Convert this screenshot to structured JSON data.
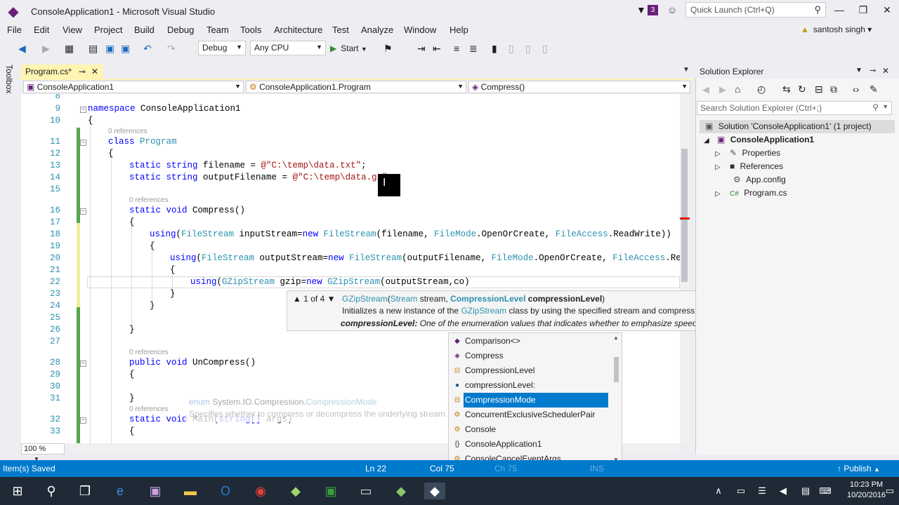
{
  "window": {
    "title": "ConsoleApplication1 - Microsoft Visual Studio",
    "notification_count": "3",
    "quick_launch_placeholder": "Quick Launch (Ctrl+Q)"
  },
  "menu": [
    "File",
    "Edit",
    "View",
    "Project",
    "Build",
    "Debug",
    "Team",
    "Tools",
    "Architecture",
    "Test",
    "Analyze",
    "Window",
    "Help"
  ],
  "user": {
    "name": "santosh singh"
  },
  "toolbar": {
    "config": "Debug",
    "platform": "Any CPU",
    "start_label": "Start"
  },
  "toolbox_label": "Toolbox",
  "document_tab": {
    "label": "Program.cs*"
  },
  "navbar": {
    "project": "ConsoleApplication1",
    "class": "ConsoleApplication1.Program",
    "member": "Compress()"
  },
  "code": {
    "refs_label": "0 references",
    "lines": {
      "l8": "8",
      "l9": "9",
      "l10": "10",
      "l11": "11",
      "l12": "12",
      "l13": "13",
      "l14": "14",
      "l15": "15",
      "l16": "16",
      "l17": "17",
      "l18": "18",
      "l19": "19",
      "l20": "20",
      "l21": "21",
      "l22": "22",
      "l23": "23",
      "l24": "24",
      "l25": "25",
      "l26": "26",
      "l27": "27",
      "l28": "28",
      "l29": "29",
      "l30": "30",
      "l31": "31",
      "l32": "32",
      "l33": "33"
    },
    "ns_kw": "namespace",
    "ns_name": " ConsoleApplication1",
    "open_brace": "{",
    "close_brace": "}",
    "class_kw": "class",
    "class_name": "Program",
    "static_string": "static string",
    "filename_decl": " filename = ",
    "filename_val": "@\"C:\\temp\\data.txt\"",
    "semicolon": ";",
    "output_decl": " outputFilename = ",
    "output_val": "@\"C:\\temp\\data.gz\"",
    "static_void": "static void",
    "compress_sig": " Compress()",
    "using_kw": "using",
    "filestream": "FileStream",
    "new_kw": "new",
    "filemode": "FileMode",
    "fileaccess": "FileAccess",
    "gzipstream": "GZipStream",
    "l18_a": " inputStream=",
    "l18_b": "(filename, ",
    "l18_c": ".OpenOrCreate, ",
    "l18_d": ".ReadWrite))",
    "l20_a": " outputStream=",
    "l20_b": "(outputFilename, ",
    "l20_c": ".OpenOrCreate, ",
    "l20_d": ".Read",
    "l22_a": " gzip=",
    "l22_b": "(outputStream,co)",
    "public_void": "public void",
    "uncompress_sig": " UnCompress()",
    "main_sig": " Main(",
    "main_args": " args)",
    "string_arr": "string[]"
  },
  "param_info": {
    "counter": "1 of 4",
    "sig_type": "GZipStream",
    "sig_p1_type": "Stream",
    "sig_p1_name": " stream, ",
    "sig_p2_type": "CompressionLevel",
    "sig_p2_name": " compressionLevel",
    "sig_close": ")",
    "paren": "(",
    "desc_a": "Initializes a new instance of the ",
    "desc_b": "GZipStream",
    "desc_c": " class by using the specified stream and compression level.",
    "param_name": "compressionLevel:",
    "param_desc": " One of the enumeration values that indicates whether to emphasize speed or compression efficiency when compressing the stream."
  },
  "intellisense": {
    "items": [
      {
        "label": "Comparison<>",
        "icon": "delegate-icon",
        "glyph": "◆"
      },
      {
        "label": "Compress",
        "icon": "method-icon",
        "glyph": "◈"
      },
      {
        "label": "CompressionLevel",
        "icon": "enum-icon",
        "glyph": "⊟"
      },
      {
        "label": "compressionLevel:",
        "icon": "parameter-icon",
        "glyph": "●"
      },
      {
        "label": "CompressionMode",
        "icon": "enum-icon",
        "glyph": "⊟"
      },
      {
        "label": "ConcurrentExclusiveSchedulerPair",
        "icon": "class-icon",
        "glyph": "⚙"
      },
      {
        "label": "Console",
        "icon": "class-icon",
        "glyph": "⚙"
      },
      {
        "label": "ConsoleApplication1",
        "icon": "namespace-icon",
        "glyph": "{}"
      },
      {
        "label": "ConsoleCancelEventArgs",
        "icon": "class-icon",
        "glyph": "⚙"
      }
    ],
    "tooltip_kind": "enum",
    "tooltip_ns": " System.IO.Compression.",
    "tooltip_name": "CompressionMode",
    "tooltip_desc": "Specifies whether to compress or decompress the underlying stream."
  },
  "zoom": "100 %",
  "solution_explorer": {
    "title": "Solution Explorer",
    "search_placeholder": "Search Solution Explorer (Ctrl+;)",
    "solution": "Solution 'ConsoleApplication1' (1 project)",
    "project": "ConsoleApplication1",
    "items": [
      "Properties",
      "References",
      "App.config",
      "Program.cs"
    ]
  },
  "status": {
    "message": "Item(s) Saved",
    "line": "Ln 22",
    "col": "Col 75",
    "ch": "Ch 75",
    "ins": "INS",
    "publish": "Publish"
  },
  "clock": {
    "time": "10:23 PM",
    "date": "10/20/2016"
  },
  "colors": {
    "accent": "#007acc",
    "vs_purple": "#68217a",
    "keyword": "#0000ff",
    "type": "#2b91af",
    "string": "#a31515"
  }
}
